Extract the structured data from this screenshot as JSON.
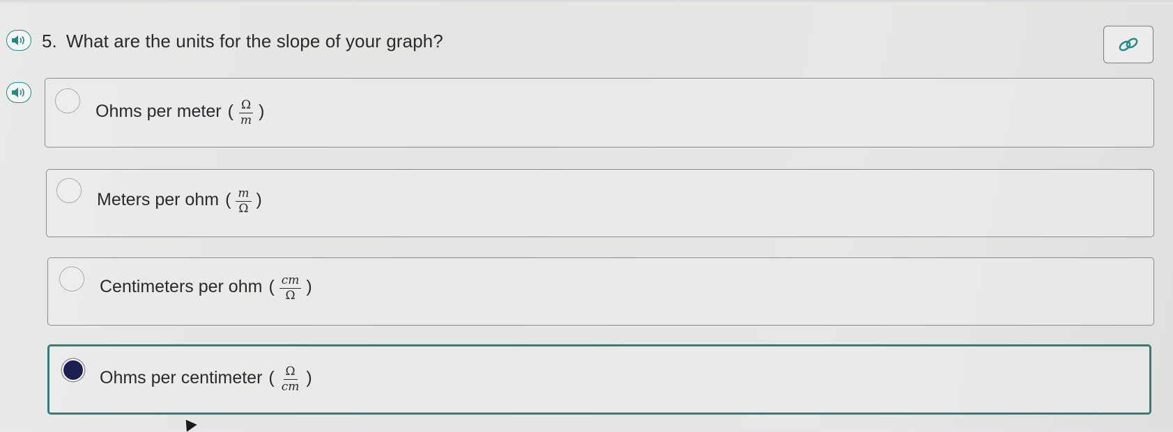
{
  "question": {
    "number": "5.",
    "text": "What are the units for the slope of your graph?"
  },
  "options": [
    {
      "label": "Ohms per meter",
      "open_paren": "(",
      "close_paren": ")",
      "numerator": "Ω",
      "denominator": "m",
      "selected": false
    },
    {
      "label": "Meters per ohm",
      "open_paren": "(",
      "close_paren": ")",
      "numerator": "m",
      "denominator": "Ω",
      "selected": false
    },
    {
      "label": "Centimeters per ohm",
      "open_paren": "(",
      "close_paren": ")",
      "numerator": "cm",
      "denominator": "Ω",
      "selected": false
    },
    {
      "label": "Ohms per centimeter",
      "open_paren": "(",
      "close_paren": ")",
      "numerator": "Ω",
      "denominator": "cm",
      "selected": true
    }
  ],
  "icons": {
    "audio": "speaker-icon",
    "link": "link-icon",
    "cursor": "mouse-cursor-icon"
  },
  "colors": {
    "accent": "#2c7f7b",
    "selected_radio": "#1e1f52",
    "border": "#8a8a8a",
    "text": "#2a2a2e"
  }
}
